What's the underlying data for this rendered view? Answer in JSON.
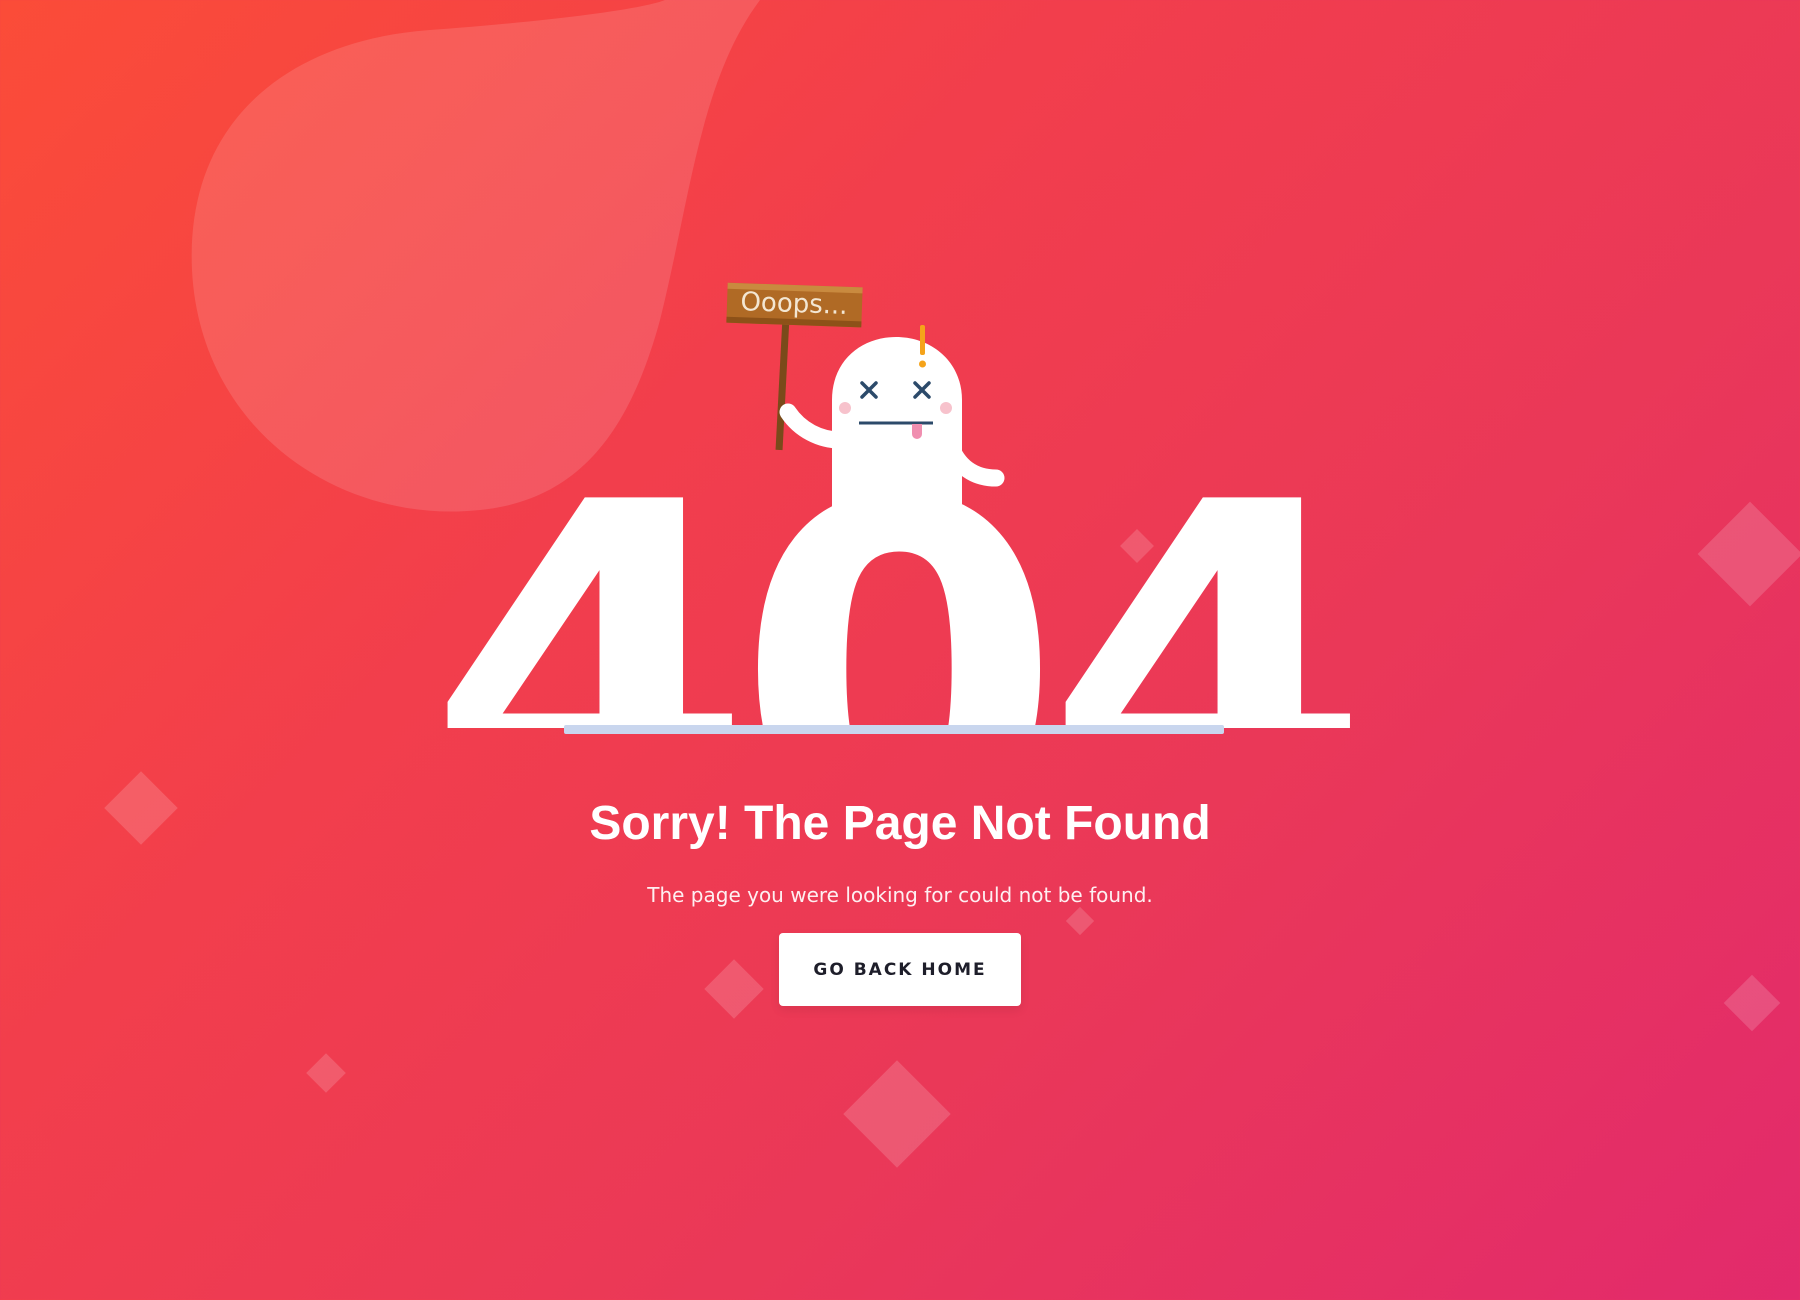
{
  "sign": {
    "text": "Ooops..."
  },
  "error_code": "404",
  "heading": "Sorry! The Page Not Found",
  "message": "The page you were looking for could not be found.",
  "button": {
    "label": "GO BACK HOME"
  },
  "colors": {
    "gradient_start": "#fb4c38",
    "gradient_end": "#e22a6c",
    "button_bg": "#ffffff",
    "button_text": "#1e1e2a",
    "exclamation": "#f5a31a",
    "ghost": "#ffffff",
    "ground_line": "#c9d6ee"
  }
}
